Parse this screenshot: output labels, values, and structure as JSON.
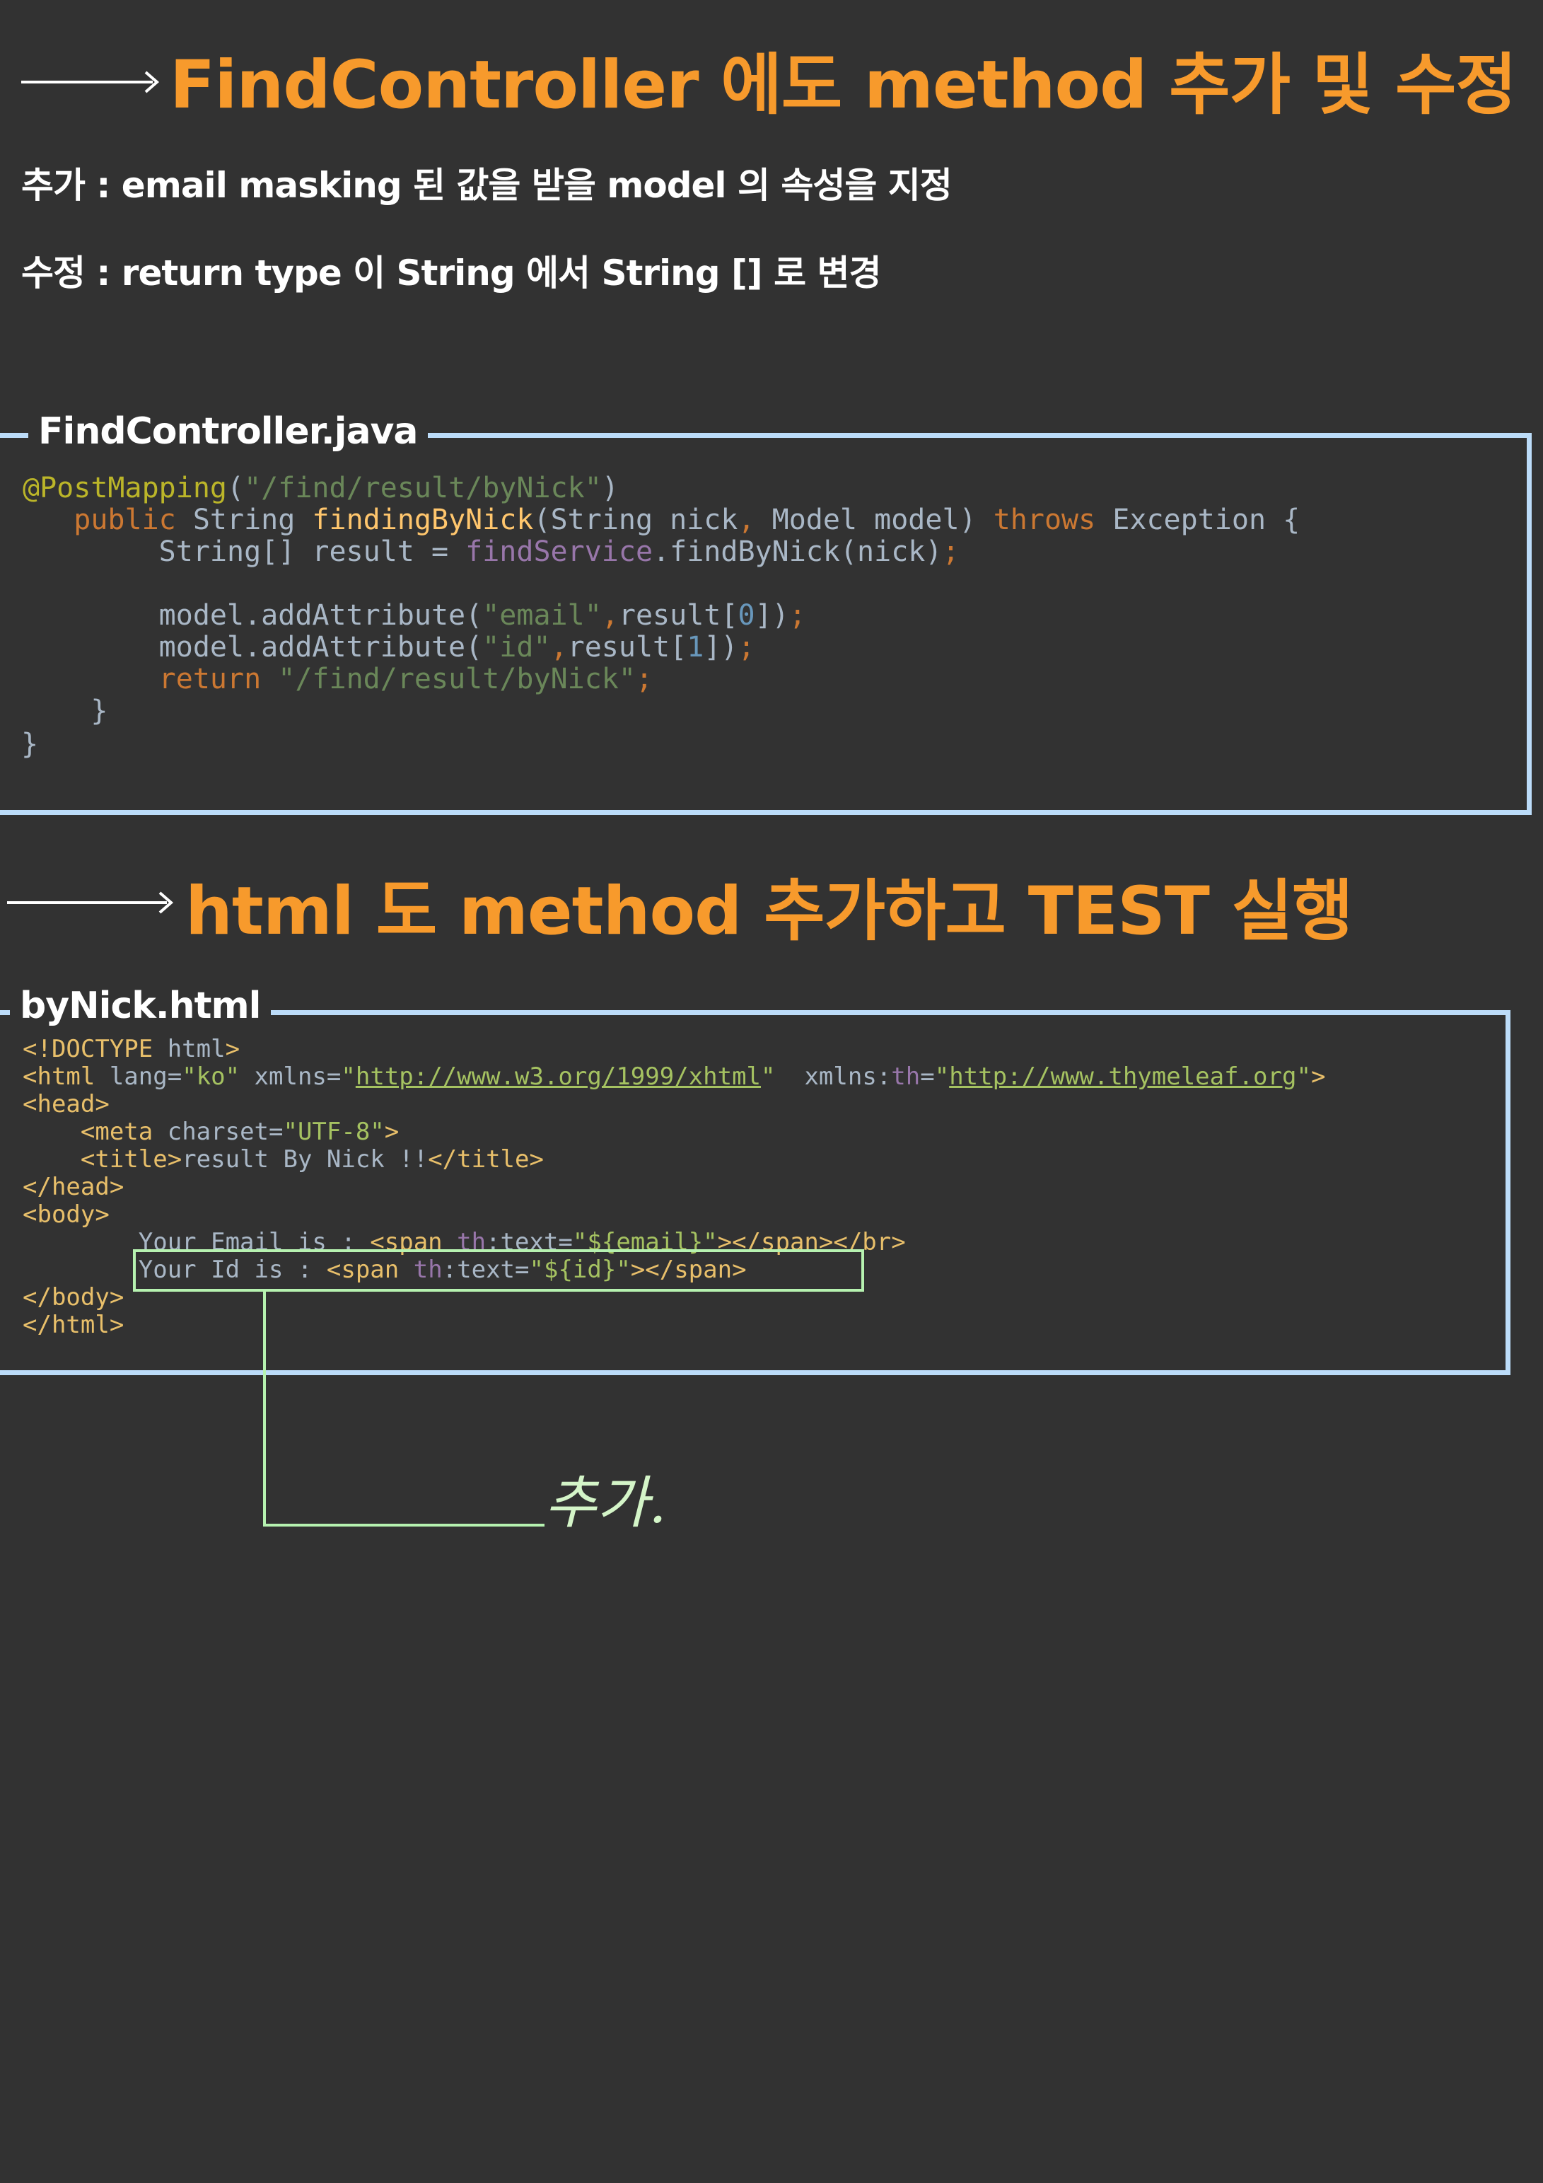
{
  "section1": {
    "title": "FindController 에도 method 추가 및 수정",
    "note_add": "추가 : email masking 된 값을 받을 model 의 속성을 지정",
    "note_modify": "수정 :  return type 이 String 에서 String [] 로 변경",
    "file_label": "FindController.java",
    "code": {
      "l1_ann": "@PostMapping",
      "l1_p1": "(",
      "l1_str": "\"/find/result/byNick\"",
      "l1_p2": ")",
      "l2_indent": "   ",
      "l2_kw": "public",
      "l2_t1": " String ",
      "l2_fn": "findingByNick",
      "l2_t2": "(String nick",
      "l2_comma": ",",
      "l2_t3": " Model model) ",
      "l2_kw2": "throws",
      "l2_t4": " Exception {",
      "l3_t1": "        String[] result = ",
      "l3_fld": "findService",
      "l3_t2": ".findByNick(nick)",
      "l3_semi": ";",
      "l5_t1": "        model.addAttribute(",
      "l5_str": "\"email\"",
      "l5_comma": ",",
      "l5_t2": "result[",
      "l5_num": "0",
      "l5_t3": "])",
      "l5_semi": ";",
      "l6_t1": "        model.addAttribute(",
      "l6_str": "\"id\"",
      "l6_comma": ",",
      "l6_t2": "result[",
      "l6_num": "1",
      "l6_t3": "])",
      "l6_semi": ";",
      "l7_indent": "        ",
      "l7_kw": "return",
      "l7_sp": " ",
      "l7_str": "\"/find/result/byNick\"",
      "l7_semi": ";",
      "l8": "    }",
      "l9": "}"
    }
  },
  "section2": {
    "title": "html 도 method 추가하고 TEST 실행",
    "file_label": "byNick.html",
    "code": {
      "h1_tag": "<!DOCTYPE",
      "h1_t": " html",
      "h1_end": ">",
      "h2_tag": "<html",
      "h2_a1": " lang=",
      "h2_v1": "\"ko\"",
      "h2_a2": " xmlns=",
      "h2_q1": "\"",
      "h2_u1": "http://www.w3.org/1999/xhtml",
      "h2_q2": "\"",
      "h2_a3": "  xmlns:",
      "h2_th": "th",
      "h2_eq": "=",
      "h2_q3": "\"",
      "h2_u2": "http://www.thymeleaf.org",
      "h2_q4": "\"",
      "h2_end": ">",
      "h3_tag": "<head>",
      "h4_indent": "    ",
      "h4_tag": "<meta",
      "h4_a": " charset=",
      "h4_v": "\"UTF-8\"",
      "h4_end": ">",
      "h5_indent": "    ",
      "h5_tag1": "<title>",
      "h5_t": "result By Nick !!",
      "h5_tag2": "</title>",
      "h6_tag": "</head>",
      "h7_tag": "<body>",
      "h8_t": "        Your Email is : ",
      "h8_tag1": "<span",
      "h8_sp": " ",
      "h8_th": "th",
      "h8_a": ":text=",
      "h8_v": "\"${email}\"",
      "h8_tag2": "></span></br>",
      "h9_t": "        Your Id is : ",
      "h9_tag1": "<span",
      "h9_sp": " ",
      "h9_th": "th",
      "h9_a": ":text=",
      "h9_v": "\"${id}\"",
      "h9_tag2": "></span>",
      "h10_tag": "</body>",
      "h11_tag": "</html>"
    },
    "handwritten_note": "추가."
  },
  "colors": {
    "background": "#323232",
    "heading": "#f79a2c",
    "code_box_border": "#bcdcf9",
    "highlight": "#b6f2b0"
  }
}
